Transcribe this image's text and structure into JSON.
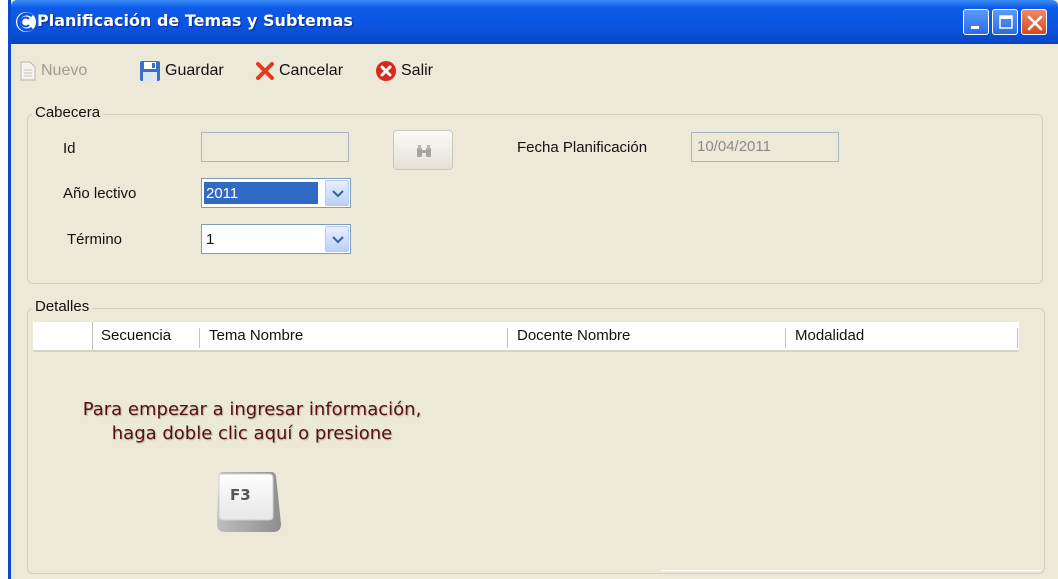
{
  "window": {
    "title": "Planificación de Temas y Subtemas",
    "title_color": "#ffffff",
    "titlebar_color": "#0a54e0"
  },
  "toolbar": {
    "nuevo_label": "Nuevo",
    "nuevo_icon": "new-document-icon",
    "guardar_label": "Guardar",
    "guardar_icon": "floppy-disk-icon",
    "cancelar_label": "Cancelar",
    "cancelar_icon": "red-x-icon",
    "salir_label": "Salir",
    "salir_icon": "close-circle-icon"
  },
  "cabecera": {
    "legend": "Cabecera",
    "id_label": "Id",
    "id_value": "",
    "search_icon": "binoculars-icon",
    "fecha_label": "Fecha Planificación",
    "fecha_value": "10/04/2011",
    "anio_label": "Año lectivo",
    "anio_value": "2011",
    "termino_label": "Término",
    "termino_value": "1"
  },
  "detalles": {
    "legend": "Detalles",
    "columns": [
      "Secuencia",
      "Tema Nombre",
      "Docente Nombre",
      "Modalidad"
    ],
    "hint_line1": "Para empezar a ingresar información,",
    "hint_line2": "haga doble clic aquí o presione",
    "key_label": "F3"
  }
}
